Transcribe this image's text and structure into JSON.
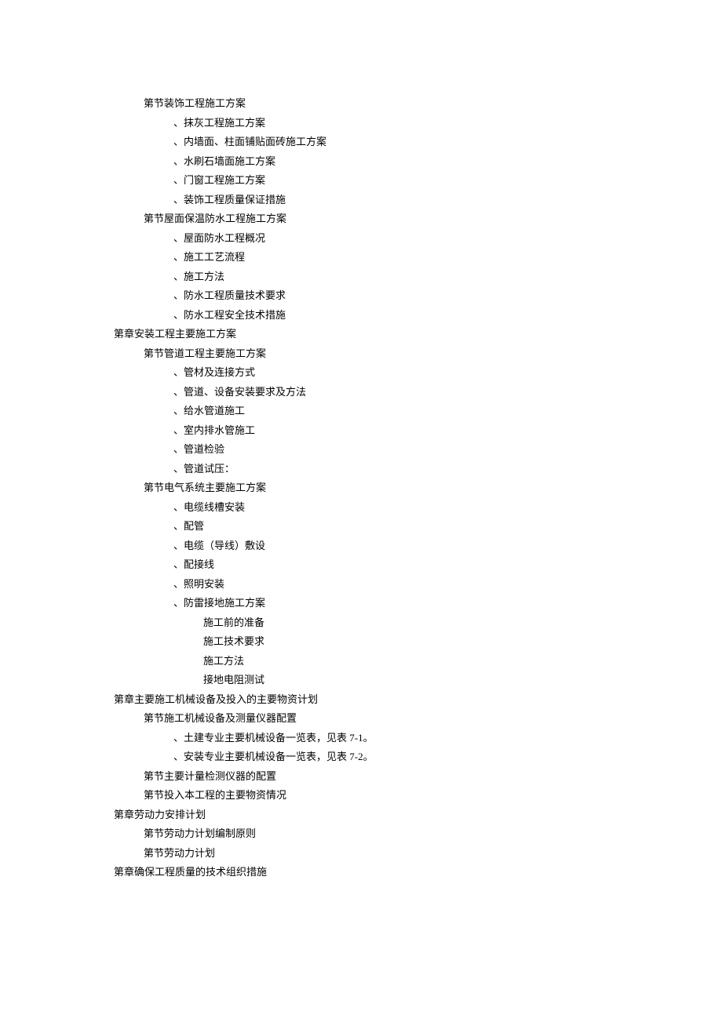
{
  "toc": [
    {
      "level": 2,
      "text": "第节装饰工程施工方案"
    },
    {
      "level": 3,
      "text": "、抹灰工程施工方案"
    },
    {
      "level": 3,
      "text": "、内墙面、柱面铺贴面砖施工方案"
    },
    {
      "level": 3,
      "text": "、水刷石墙面施工方案"
    },
    {
      "level": 3,
      "text": "、门窗工程施工方案"
    },
    {
      "level": 3,
      "text": "、装饰工程质量保证措施"
    },
    {
      "level": 2,
      "text": "第节屋面保温防水工程施工方案"
    },
    {
      "level": 3,
      "text": "、屋面防水工程概况"
    },
    {
      "level": 3,
      "text": "、施工工艺流程"
    },
    {
      "level": 3,
      "text": "、施工方法"
    },
    {
      "level": 3,
      "text": "、防水工程质量技术要求"
    },
    {
      "level": 3,
      "text": "、防水工程安全技术措施"
    },
    {
      "level": 1,
      "text": "第章安装工程主要施工方案"
    },
    {
      "level": 2,
      "text": "第节管道工程主要施工方案"
    },
    {
      "level": 3,
      "text": "、管材及连接方式"
    },
    {
      "level": 3,
      "text": "、管道、设备安装要求及方法"
    },
    {
      "level": 3,
      "text": "、给水管道施工"
    },
    {
      "level": 3,
      "text": "、室内排水管施工"
    },
    {
      "level": 3,
      "text": "、管道检验"
    },
    {
      "level": 3,
      "text": "、管道试压："
    },
    {
      "level": 2,
      "text": "第节电气系统主要施工方案"
    },
    {
      "level": 3,
      "text": "、电缆线槽安装"
    },
    {
      "level": 3,
      "text": "、配管"
    },
    {
      "level": 3,
      "text": "、电缆（导线）敷设"
    },
    {
      "level": 3,
      "text": "、配接线"
    },
    {
      "level": 3,
      "text": "、照明安装"
    },
    {
      "level": 3,
      "text": "、防雷接地施工方案"
    },
    {
      "level": 4,
      "text": "施工前的准备"
    },
    {
      "level": 4,
      "text": "施工技术要求"
    },
    {
      "level": 4,
      "text": "施工方法"
    },
    {
      "level": 4,
      "text": "接地电阻测试"
    },
    {
      "level": 1,
      "text": "第章主要施工机械设备及投入的主要物资计划"
    },
    {
      "level": 2,
      "text": "第节施工机械设备及测量仪器配置"
    },
    {
      "level": 3,
      "text": "、土建专业主要机械设备一览表，见表 7-1。"
    },
    {
      "level": 3,
      "text": "、安装专业主要机械设备一览表，见表 7-2。"
    },
    {
      "level": 2,
      "text": "第节主要计量检测仪器的配置"
    },
    {
      "level": 2,
      "text": "第节投入本工程的主要物资情况"
    },
    {
      "level": 1,
      "text": "第章劳动力安排计划"
    },
    {
      "level": 2,
      "text": "第节劳动力计划编制原则"
    },
    {
      "level": 2,
      "text": "第节劳动力计划"
    },
    {
      "level": 1,
      "text": "第章确保工程质量的技术组织措施"
    }
  ]
}
